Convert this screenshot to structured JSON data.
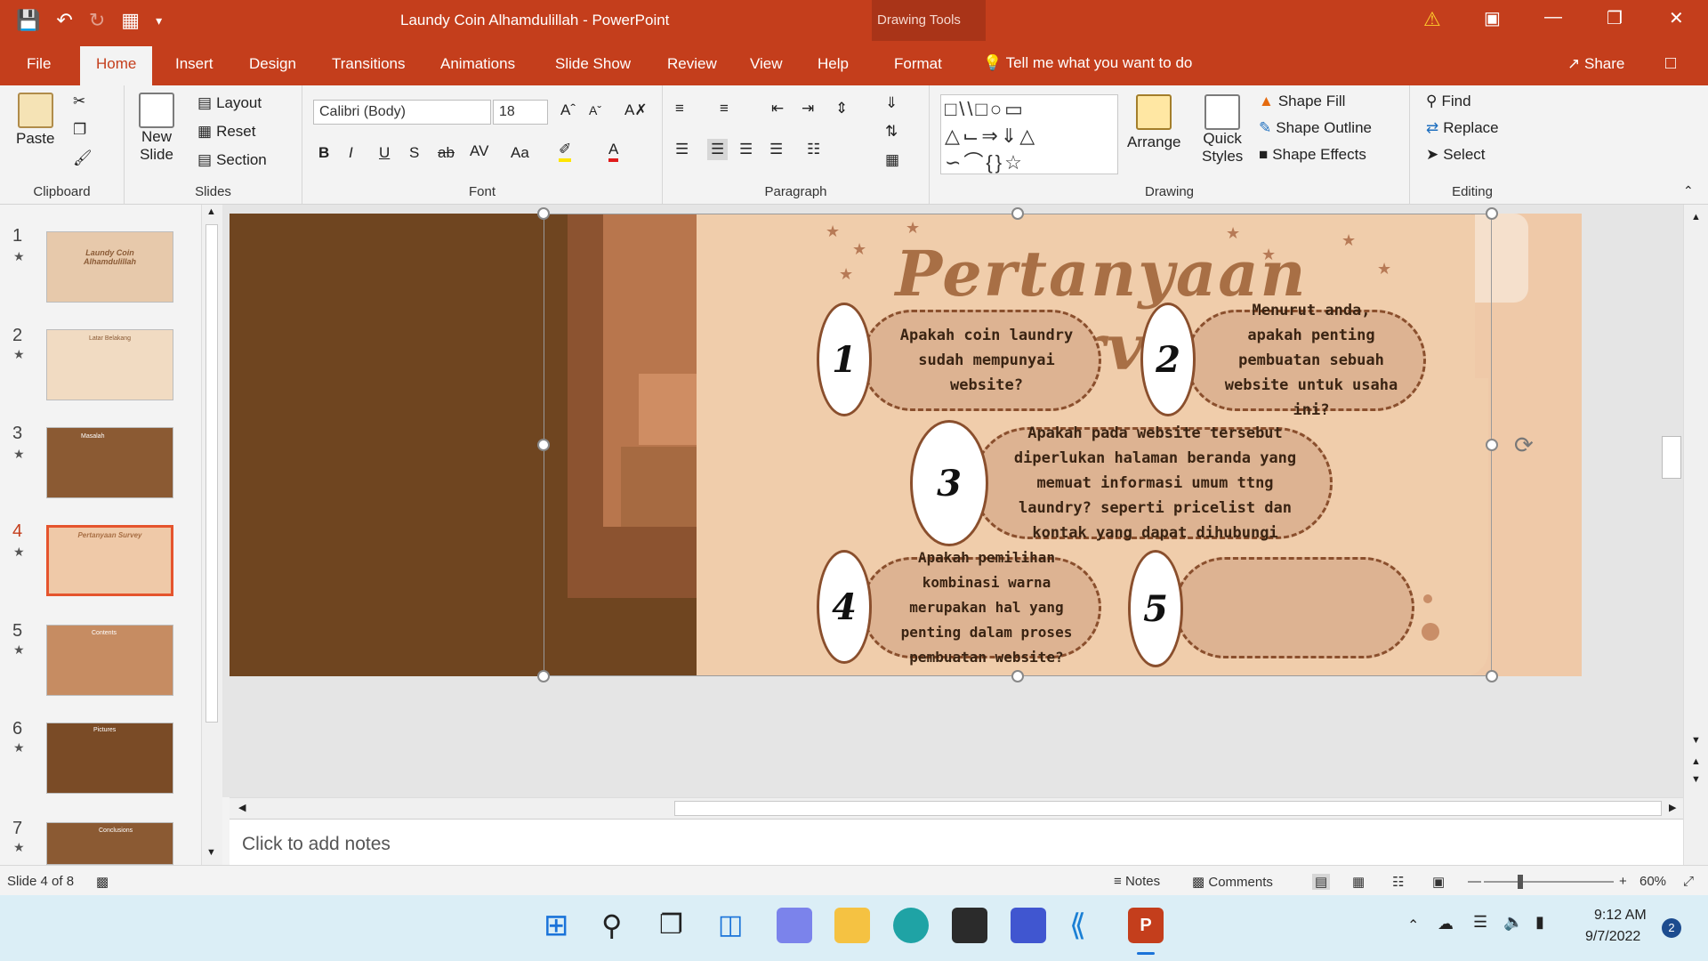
{
  "titlebar": {
    "doc_title": "Laundy Coin Alhamdulillah  -  PowerPoint",
    "context_group": "Drawing Tools"
  },
  "tabs": [
    "File",
    "Home",
    "Insert",
    "Design",
    "Transitions",
    "Animations",
    "Slide Show",
    "Review",
    "View",
    "Help",
    "Format"
  ],
  "active_tab": "Home",
  "tell_me": "Tell me what you want to do",
  "share": "Share",
  "ribbon": {
    "clipboard": {
      "paste": "Paste",
      "label": "Clipboard"
    },
    "slides": {
      "new_slide": "New",
      "new_slide2": "Slide",
      "layout": "Layout",
      "reset": "Reset",
      "section": "Section",
      "label": "Slides"
    },
    "font": {
      "family": "Calibri (Body)",
      "size": "18",
      "label": "Font",
      "bold": "B",
      "italic": "I",
      "underline": "U",
      "shadow": "S",
      "strike": "ab",
      "spacing": "AV",
      "case": "Aa"
    },
    "paragraph": {
      "label": "Paragraph"
    },
    "drawing": {
      "arrange": "Arrange",
      "quick_styles": "Quick",
      "quick_styles2": "Styles",
      "shape_fill": "Shape Fill",
      "shape_outline": "Shape Outline",
      "shape_effects": "Shape Effects",
      "label": "Drawing"
    },
    "editing": {
      "find": "Find",
      "replace": "Replace",
      "select": "Select",
      "label": "Editing"
    }
  },
  "thumbnails": [
    {
      "num": "1",
      "title": "Laundy Coin Alhamdulillah"
    },
    {
      "num": "2",
      "title": "Latar Belakang"
    },
    {
      "num": "3",
      "title": "Masalah"
    },
    {
      "num": "4",
      "title": "Pertanyaan Survey"
    },
    {
      "num": "5",
      "title": "Contents"
    },
    {
      "num": "6",
      "title": "Pictures"
    },
    {
      "num": "7",
      "title": "Conclusions"
    }
  ],
  "active_slide": 4,
  "slide": {
    "title": "Pertanyaan Survey",
    "questions": [
      {
        "num": "1",
        "text": "Apakah coin laundry sudah mempunyai website?"
      },
      {
        "num": "2",
        "text": "Menurut anda, apakah penting pembuatan sebuah website untuk usaha ini?"
      },
      {
        "num": "3",
        "text": "Apakah pada website tersebut diperlukan halaman beranda yang memuat informasi umum ttng laundry? seperti pricelist dan kontak yang dapat dihubungi"
      },
      {
        "num": "4",
        "text": "Apakah pemilihan kombinasi warna merupakan hal yang penting dalam proses pembuatan website?"
      },
      {
        "num": "5",
        "text": ""
      }
    ]
  },
  "notes_placeholder": "Click to add notes",
  "status": {
    "slide_of": "Slide 4 of 8",
    "notes": "Notes",
    "comments": "Comments",
    "zoom": "60%"
  },
  "taskbar": {
    "time": "9:12 AM",
    "date": "9/7/2022",
    "notif_count": "2"
  },
  "colors": {
    "accent": "#c43e1c",
    "slide_bg": "#efc9a8",
    "brown": "#6f4520",
    "pill": "#ddb392"
  }
}
